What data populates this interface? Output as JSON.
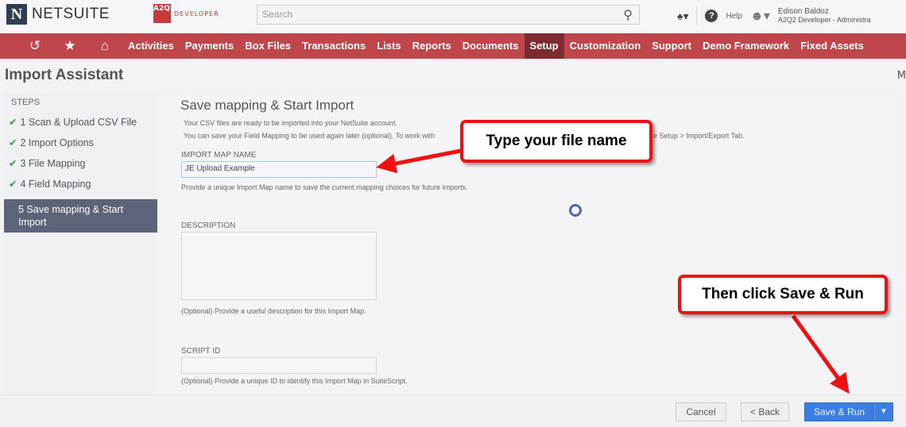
{
  "header": {
    "logo": "NETSUITE",
    "dev_badge": "A2Q2",
    "dev_label": "DEVELOPER",
    "search_placeholder": "Search",
    "help": "Help",
    "user_name": "Edison Baldoz",
    "user_role": "A2Q2 Developer - Administra"
  },
  "nav": {
    "items": [
      "Activities",
      "Payments",
      "Box Files",
      "Transactions",
      "Lists",
      "Reports",
      "Documents",
      "Setup",
      "Customization",
      "Support",
      "Demo Framework",
      "Fixed Assets"
    ],
    "active": "Setup"
  },
  "page": {
    "title": "Import Assistant",
    "right_cut": "M"
  },
  "steps": {
    "heading": "STEPS",
    "items": [
      {
        "label": "1 Scan & Upload CSV File",
        "done": true
      },
      {
        "label": "2 Import Options",
        "done": true
      },
      {
        "label": "3 File Mapping",
        "done": true
      },
      {
        "label": "4 Field Mapping",
        "done": true
      },
      {
        "label": "5 Save mapping & Start Import",
        "done": false
      }
    ]
  },
  "content": {
    "title": "Save mapping & Start Import",
    "line1": "Your CSV files are ready to be imported into your NetSuite account.",
    "line2a": "You can save your Field Mapping to be used again later (optional). To work with",
    "line2b": "e Setup > Import/Export Tab.",
    "map_name_label": "IMPORT MAP NAME",
    "map_name_value": "JE Upload Example",
    "map_name_help": "Provide a unique Import Map name to save the current mapping choices for future imports.",
    "description_label": "DESCRIPTION",
    "description_help": "(Optional) Provide a useful description for this Import Map.",
    "script_id_label": "SCRIPT ID",
    "script_id_help": "(Optional) Provide a unique ID to identify this Import Map in SuiteScript."
  },
  "footer": {
    "cancel": "Cancel",
    "back": "< Back",
    "save_run": "Save & Run",
    "dropdown": "▼"
  },
  "callouts": {
    "first": "Type your file name",
    "second": "Then click Save & Run"
  }
}
